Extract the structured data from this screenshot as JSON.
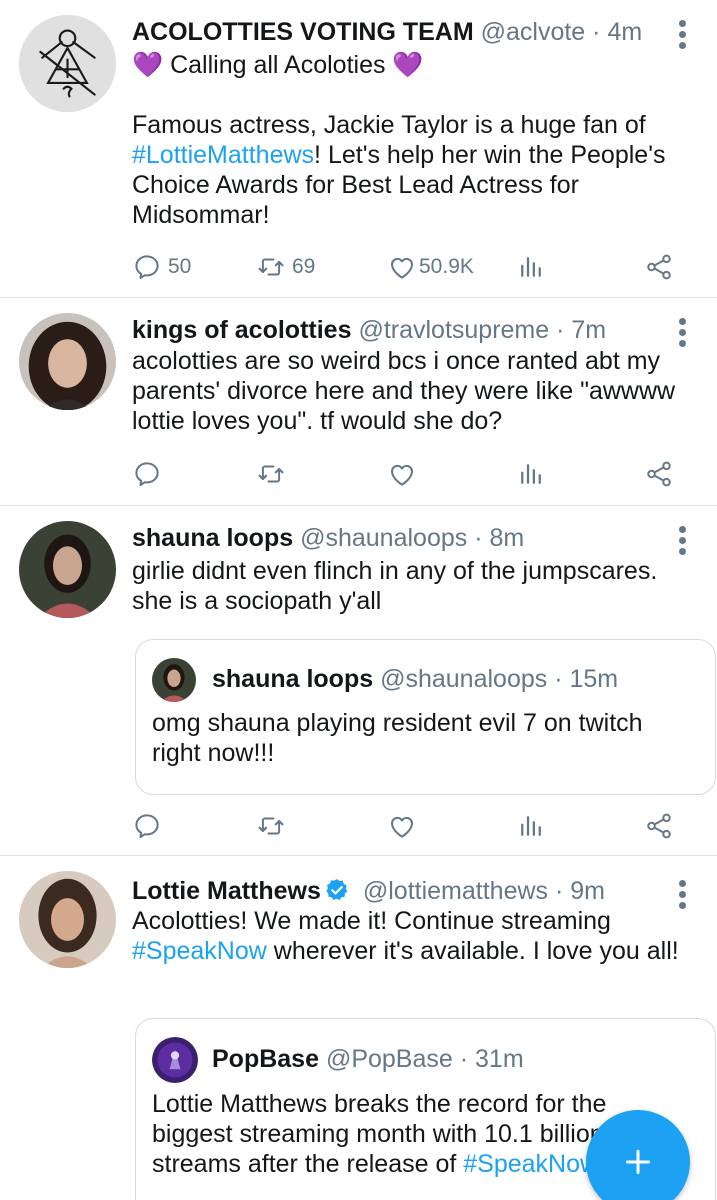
{
  "tweets": [
    {
      "name": "ACOLOTTIES VOTING TEAM",
      "handle": "@aclvote",
      "time": "· 4m",
      "avatar_icon": "sigil-logo-icon",
      "line1": "💜 Calling all Acoloties 💜",
      "text_before": "Famous actress, Jackie Taylor is a huge fan of ",
      "hashtag": "#LottieMatthews",
      "text_after": "! Let's help her win the People's Choice Awards for Best Lead Actress for Midsommar!",
      "replies": "50",
      "retweets": "69",
      "likes": "50.9K"
    },
    {
      "name": "kings of acolotties",
      "handle": "@travlotsupreme",
      "time": "· 7m",
      "text": "acolotties are so weird bcs i once ranted abt my parents' divorce here and they were like \"awwww lottie loves you\". tf would she do?"
    },
    {
      "name": "shauna loops",
      "handle": "@shaunaloops",
      "time": "· 8m",
      "text": "girlie didnt even flinch in any of the jumpscares. she is a sociopath y'all",
      "quote": {
        "name": "shauna loops",
        "handle": "@shaunaloops",
        "time": "· 15m",
        "text": "omg shauna playing resident evil 7 on twitch right now!!!"
      }
    },
    {
      "name": "Lottie Matthews",
      "handle": "@lottiematthews",
      "time": "· 9m",
      "verified": true,
      "text_before": "Acolotties! We made it! Continue streaming ",
      "hashtag": "#SpeakNow",
      "text_after": " wherever it's available. I love you all!",
      "quote": {
        "name": "PopBase",
        "handle": "@PopBase",
        "time": "· 31m",
        "text_before": "Lottie Matthews breaks the record for the biggest streaming month with 10.1 billion streams after the release of ",
        "hashtag": "#SpeakNow"
      }
    }
  ],
  "fab": {
    "icon": "compose-plus-icon"
  },
  "colors": {
    "accent": "#1da1f2",
    "muted": "#657786",
    "text": "#14171a",
    "divider": "#dfe3e6"
  }
}
